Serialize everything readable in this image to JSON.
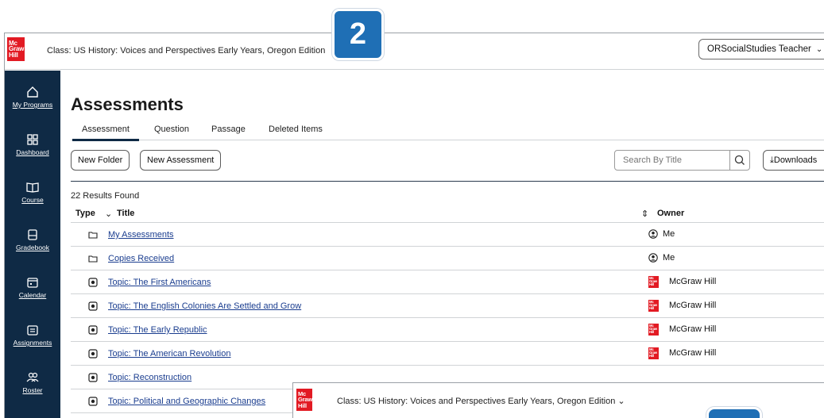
{
  "app": {
    "logo_text": "Mc Graw Hill",
    "class_title": "Class: US History: Voices and Perspectives Early Years, Oregon Edition",
    "user_menu": "ORSocialStudies Teacher"
  },
  "callout_badge": "2",
  "sidebar": {
    "items": [
      {
        "label": "My Programs",
        "icon": "home-icon"
      },
      {
        "label": "Dashboard",
        "icon": "dashboard-icon"
      },
      {
        "label": "Course",
        "icon": "book-icon"
      },
      {
        "label": "Gradebook",
        "icon": "gradebook-icon"
      },
      {
        "label": "Calendar",
        "icon": "calendar-icon"
      },
      {
        "label": "Assignments",
        "icon": "assignments-icon"
      },
      {
        "label": "Roster",
        "icon": "roster-icon"
      }
    ]
  },
  "main": {
    "page_title": "Assessments",
    "tabs": [
      {
        "label": "Assessment",
        "active": true
      },
      {
        "label": "Question",
        "active": false
      },
      {
        "label": "Passage",
        "active": false
      },
      {
        "label": "Deleted Items",
        "active": false
      }
    ],
    "toolbar": {
      "new_folder": "New Folder",
      "new_assessment": "New Assessment",
      "search_placeholder": "Search By Title",
      "downloads": "Downloads"
    },
    "results_count": "22 Results Found",
    "columns": {
      "type": "Type",
      "title": "Title",
      "owner": "Owner"
    },
    "rows": [
      {
        "type": "folder",
        "title": "My Assessments",
        "owner": "Me"
      },
      {
        "type": "folder",
        "title": "Copies Received",
        "owner": "Me"
      },
      {
        "type": "assessment",
        "title": "Topic: The First Americans",
        "owner": "McGraw Hill"
      },
      {
        "type": "assessment",
        "title": "Topic: The English Colonies Are Settled and Grow",
        "owner": "McGraw Hill"
      },
      {
        "type": "assessment",
        "title": "Topic: The Early Republic",
        "owner": "McGraw Hill"
      },
      {
        "type": "assessment",
        "title": "Topic: The American Revolution",
        "owner": "McGraw Hill"
      },
      {
        "type": "assessment",
        "title": "Topic: Reconstruction",
        "owner": ""
      },
      {
        "type": "assessment",
        "title": "Topic: Political and Geographic Changes",
        "owner": ""
      }
    ]
  },
  "overlay": {
    "class_title": "Class: US History: Voices and Perspectives Early Years, Oregon Edition"
  },
  "colors": {
    "brand_red": "#e21a23",
    "sidebar": "#0f2a45",
    "badge_blue": "#1f6fb5",
    "link": "#1a3d8f"
  }
}
